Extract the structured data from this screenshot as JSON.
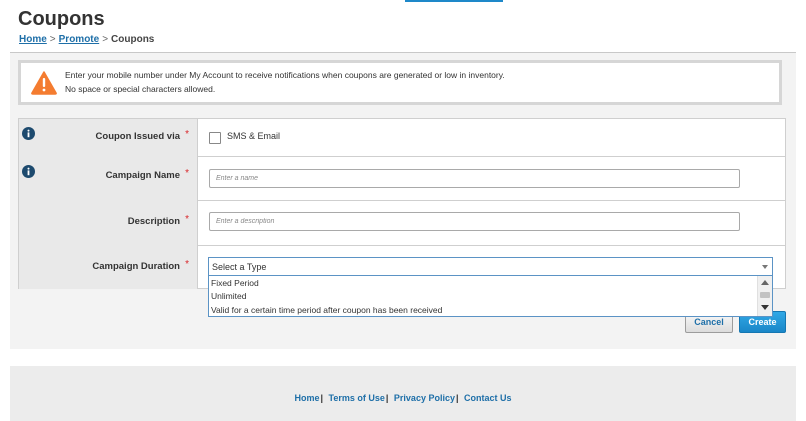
{
  "page": {
    "title": "Coupons",
    "breadcrumb": [
      {
        "label": "Home",
        "link": true
      },
      {
        "label": "Promote",
        "link": true
      },
      {
        "label": "Coupons",
        "link": false
      }
    ]
  },
  "alert": {
    "icon": "warning-icon",
    "color": "#f47c30",
    "line1": "Enter your mobile number under My Account to receive notifications when coupons are generated or low in inventory.",
    "line2": "No space or special characters allowed."
  },
  "form": {
    "coupon_issued_via": {
      "label": "Coupon Issued via",
      "required_mark": "*",
      "option_label": "SMS & Email",
      "checked": false
    },
    "campaign_name": {
      "label": "Campaign Name",
      "required_mark": "*",
      "placeholder": "Enter a name",
      "value": ""
    },
    "description": {
      "label": "Description",
      "required_mark": "*",
      "placeholder": "Enter a description",
      "value": ""
    },
    "campaign_duration": {
      "label": "Campaign Duration",
      "required_mark": "*",
      "selected": "Select a Type",
      "options": [
        "Fixed Period",
        "Unlimited",
        "Valid for a certain time period after coupon has been received"
      ]
    }
  },
  "buttons": {
    "cancel": "Cancel",
    "create": "Create"
  },
  "footer": {
    "links": [
      "Home",
      "Terms of Use",
      "Privacy Policy",
      "Contact Us"
    ],
    "separator": "|"
  },
  "colors": {
    "accent": "#1e6fa8",
    "required": "#d9262a",
    "create_button": "#1a87c8"
  }
}
